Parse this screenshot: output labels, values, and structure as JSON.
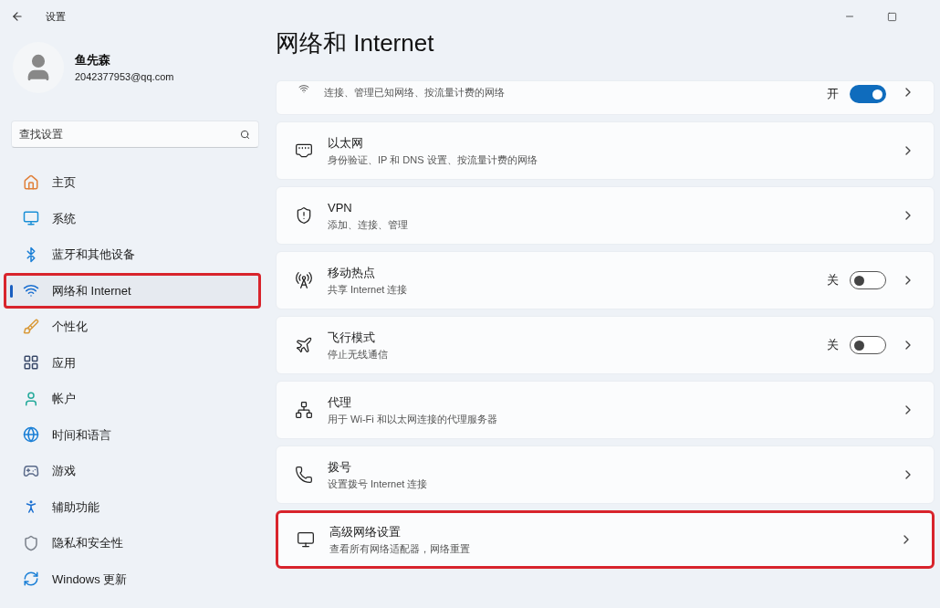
{
  "window": {
    "title": "设置"
  },
  "user": {
    "name": "鱼先森",
    "email": "2042377953@qq.com"
  },
  "search": {
    "placeholder": "查找设置"
  },
  "sidebar": {
    "items": [
      {
        "label": "主页",
        "selected": false,
        "highlighted": false
      },
      {
        "label": "系统",
        "selected": false,
        "highlighted": false
      },
      {
        "label": "蓝牙和其他设备",
        "selected": false,
        "highlighted": false
      },
      {
        "label": "网络和 Internet",
        "selected": true,
        "highlighted": true
      },
      {
        "label": "个性化",
        "selected": false,
        "highlighted": false
      },
      {
        "label": "应用",
        "selected": false,
        "highlighted": false
      },
      {
        "label": "帐户",
        "selected": false,
        "highlighted": false
      },
      {
        "label": "时间和语言",
        "selected": false,
        "highlighted": false
      },
      {
        "label": "游戏",
        "selected": false,
        "highlighted": false
      },
      {
        "label": "辅助功能",
        "selected": false,
        "highlighted": false
      },
      {
        "label": "隐私和安全性",
        "selected": false,
        "highlighted": false
      },
      {
        "label": "Windows 更新",
        "selected": false,
        "highlighted": false
      }
    ]
  },
  "page": {
    "heading": "网络和 Internet",
    "cards": [
      {
        "subtitle": "连接、管理已知网络、按流量计费的网络",
        "kind": "toggle",
        "state_label": "开",
        "on": true,
        "highlighted": false
      },
      {
        "title": "以太网",
        "subtitle": "身份验证、IP 和 DNS 设置、按流量计费的网络",
        "kind": "link",
        "highlighted": false
      },
      {
        "title": "VPN",
        "subtitle": "添加、连接、管理",
        "kind": "link",
        "highlighted": false
      },
      {
        "title": "移动热点",
        "subtitle": "共享 Internet 连接",
        "kind": "toggle",
        "state_label": "关",
        "on": false,
        "highlighted": false
      },
      {
        "title": "飞行模式",
        "subtitle": "停止无线通信",
        "kind": "toggle",
        "state_label": "关",
        "on": false,
        "highlighted": false
      },
      {
        "title": "代理",
        "subtitle": "用于 Wi-Fi 和以太网连接的代理服务器",
        "kind": "link",
        "highlighted": false
      },
      {
        "title": "拨号",
        "subtitle": "设置拨号 Internet 连接",
        "kind": "link",
        "highlighted": false
      },
      {
        "title": "高级网络设置",
        "subtitle": "查看所有网络适配器，网络重置",
        "kind": "link",
        "highlighted": true
      }
    ]
  }
}
